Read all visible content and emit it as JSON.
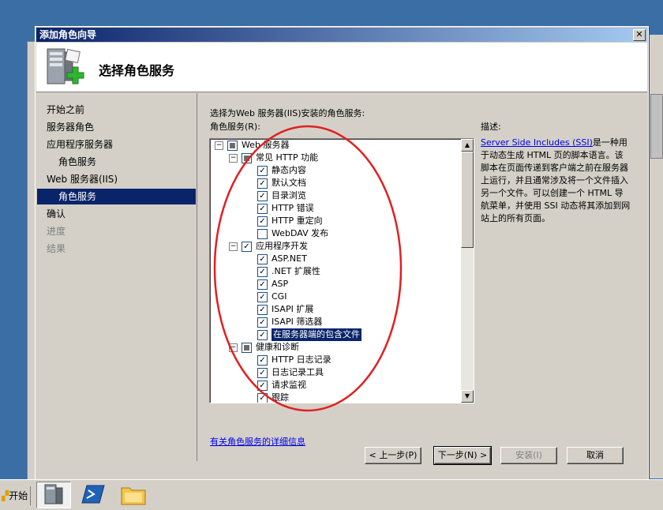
{
  "dialog": {
    "title": "添加角色向导",
    "close_label": "✕",
    "header_title": "选择角色服务"
  },
  "nav": {
    "items": [
      {
        "label": "开始之前",
        "state": "normal"
      },
      {
        "label": "服务器角色",
        "state": "normal"
      },
      {
        "label": "应用程序服务器",
        "state": "normal"
      },
      {
        "label": "角色服务",
        "state": "normal"
      },
      {
        "label": "Web 服务器(IIS)",
        "state": "normal"
      },
      {
        "label": "角色服务",
        "state": "selected"
      },
      {
        "label": "确认",
        "state": "normal"
      },
      {
        "label": "进度",
        "state": "disabled"
      },
      {
        "label": "结果",
        "state": "disabled"
      }
    ]
  },
  "content": {
    "prompt": "选择为Web 服务器(IIS)安装的角色服务:",
    "list_label": "角色服务(R):",
    "desc_label": "描述:",
    "desc_link": "Server Side Includes (SSI)",
    "desc_text": "是一种用于动态生成 HTML 页的脚本语言。该脚本在页面传递到客户端之前在服务器上运行，并且通常涉及将一个文件插入另一个文件。可以创建一个 HTML 导航菜单，并使用 SSI 动态将其添加到网站上的所有页面。",
    "more_link": "有关角色服务的详细信息"
  },
  "tree": [
    {
      "label": "Web 服务器",
      "check": "partial",
      "expander": "⊟"
    },
    {
      "label": "常见 HTTP 功能",
      "check": "partial",
      "expander": "⊟"
    },
    {
      "label": "静态内容",
      "check": "checked"
    },
    {
      "label": "默认文档",
      "check": "checked"
    },
    {
      "label": "目录浏览",
      "check": "checked"
    },
    {
      "label": "HTTP 错误",
      "check": "checked"
    },
    {
      "label": "HTTP 重定向",
      "check": "checked"
    },
    {
      "label": "WebDAV 发布",
      "check": "unchecked"
    },
    {
      "label": "应用程序开发",
      "check": "checked",
      "expander": "⊟"
    },
    {
      "label": "ASP.NET",
      "check": "checked"
    },
    {
      "label": ".NET 扩展性",
      "check": "checked"
    },
    {
      "label": "ASP",
      "check": "checked"
    },
    {
      "label": "CGI",
      "check": "checked"
    },
    {
      "label": "ISAPI 扩展",
      "check": "checked"
    },
    {
      "label": "ISAPI 筛选器",
      "check": "checked"
    },
    {
      "label": "在服务器端的包含文件",
      "check": "checked",
      "highlight": true
    },
    {
      "label": "健康和诊断",
      "check": "partial",
      "expander": "⊟"
    },
    {
      "label": "HTTP 日志记录",
      "check": "checked"
    },
    {
      "label": "日志记录工具",
      "check": "checked"
    },
    {
      "label": "请求监视",
      "check": "checked"
    },
    {
      "label": "跟踪",
      "check": "checked"
    }
  ],
  "buttons": {
    "back": "< 上一步(P)",
    "next": "下一步(N) >",
    "install": "安装(I)",
    "cancel": "取消"
  },
  "taskbar": {
    "start_label": "开始",
    "apps": [
      "server-manager-icon",
      "powershell-icon",
      "explorer-folder-icon"
    ]
  },
  "colors": {
    "title_start": "#0a246a",
    "title_end": "#a6caf0",
    "selection": "#0a246a",
    "desktop": "#3a6ea5",
    "annotation_ellipse": "#e02020"
  }
}
